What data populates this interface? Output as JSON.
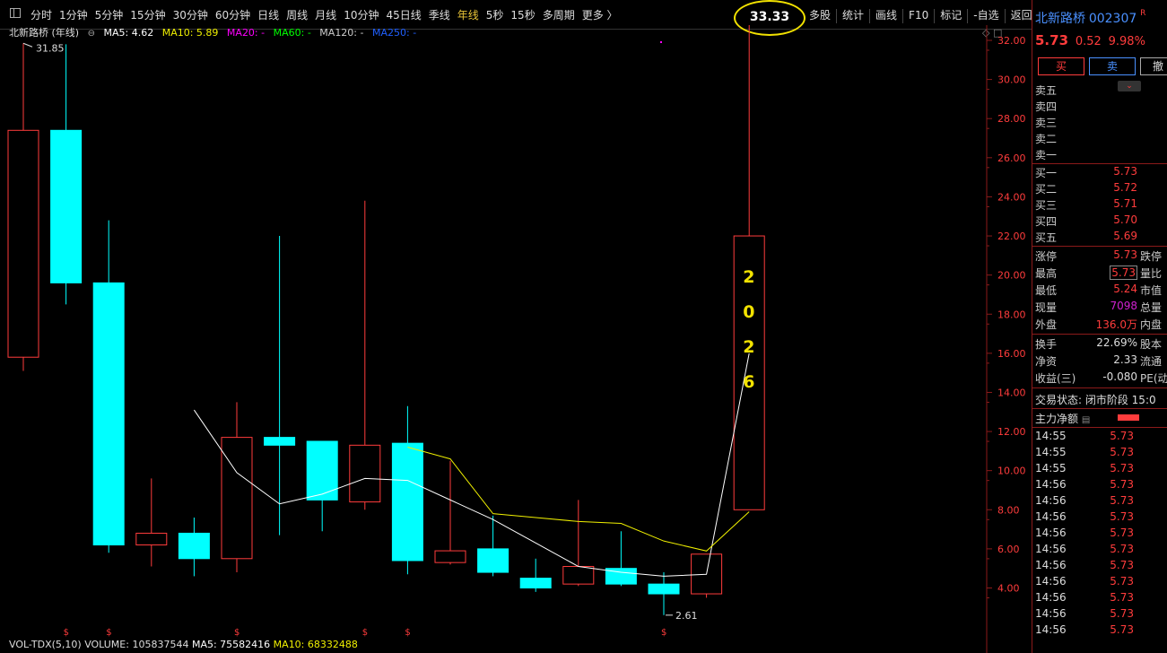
{
  "toolbar": {
    "periods": [
      "分时",
      "1分钟",
      "5分钟",
      "15分钟",
      "30分钟",
      "60分钟",
      "日线",
      "周线",
      "月线",
      "10分钟",
      "45日线",
      "季线",
      "年线",
      "5秒",
      "15秒",
      "多周期",
      "更多 〉"
    ],
    "active_period": "年线",
    "tools": [
      "多股",
      "统计",
      "画线",
      "F10",
      "标记",
      "-自选",
      "返回"
    ],
    "price_callout": "33.33"
  },
  "chart_header": {
    "stock_label": "北新路桥 (年线)",
    "ma5": "MA5: 4.62",
    "ma10": "MA10: 5.89",
    "ma20": "MA20: -",
    "ma60": "MA60: -",
    "ma120": "MA120: -",
    "ma250": "MA250: -"
  },
  "colors": {
    "up": "#ff3c3c",
    "down": "#00ffff",
    "ma5": "#ffffff",
    "ma10": "#f0f000",
    "ma20": "#ff00ff",
    "ma60": "#00ff00",
    "ma120": "#cccccc",
    "ma250": "#2060ff",
    "callout": "#f2e200"
  },
  "annotations": {
    "high_label": "31.85",
    "low_label": "2.61",
    "vertical_text": [
      "2",
      "0",
      "2",
      "6"
    ]
  },
  "volume_header": {
    "vol": "VOL-TDX(5,10)",
    "volume": "VOLUME: 105837544",
    "ma5": "MA5: 75582416",
    "ma10": "MA10: 68332488"
  },
  "chart_data": {
    "type": "candlestick",
    "y_axis_ticks": [
      "32.00",
      "30.00",
      "28.00",
      "26.00",
      "24.00",
      "22.00",
      "20.00",
      "18.00",
      "16.00",
      "14.00",
      "12.00",
      "10.00",
      "8.00",
      "6.00",
      "4.00"
    ],
    "ylim": [
      2.0,
      33.0
    ],
    "candles": [
      {
        "open": 15.8,
        "close": 27.4,
        "high": 31.85,
        "low": 15.1
      },
      {
        "open": 27.4,
        "close": 19.6,
        "high": 31.8,
        "low": 18.5
      },
      {
        "open": 19.6,
        "close": 6.2,
        "high": 22.8,
        "low": 5.8
      },
      {
        "open": 6.2,
        "close": 6.8,
        "high": 9.6,
        "low": 5.1
      },
      {
        "open": 6.8,
        "close": 5.5,
        "high": 7.6,
        "low": 4.6
      },
      {
        "open": 5.5,
        "close": 11.7,
        "high": 13.5,
        "low": 4.8
      },
      {
        "open": 11.7,
        "close": 11.3,
        "high": 22.0,
        "low": 6.7
      },
      {
        "open": 11.5,
        "close": 8.5,
        "high": 11.5,
        "low": 6.9
      },
      {
        "open": 8.4,
        "close": 11.3,
        "high": 23.8,
        "low": 8.0
      },
      {
        "open": 11.4,
        "close": 5.4,
        "high": 13.3,
        "low": 4.7
      },
      {
        "open": 5.3,
        "close": 5.9,
        "high": 10.5,
        "low": 5.2
      },
      {
        "open": 6.0,
        "close": 4.8,
        "high": 7.7,
        "low": 4.6
      },
      {
        "open": 4.5,
        "close": 4.0,
        "high": 5.5,
        "low": 3.8
      },
      {
        "open": 4.2,
        "close": 5.1,
        "high": 8.5,
        "low": 4.1
      },
      {
        "open": 5.0,
        "close": 4.2,
        "high": 6.9,
        "low": 4.1
      },
      {
        "open": 4.2,
        "close": 3.7,
        "high": 4.8,
        "low": 2.61
      },
      {
        "open": 3.7,
        "close": 5.73,
        "high": 5.73,
        "low": 3.5
      },
      {
        "open": 8.0,
        "close": 22.0,
        "high": 33.33,
        "low": 8.0
      }
    ],
    "ma5_line": [
      null,
      null,
      null,
      null,
      13.1,
      9.9,
      8.3,
      8.8,
      9.6,
      9.5,
      8.5,
      7.5,
      6.3,
      5.1,
      4.8,
      4.6,
      4.7,
      16.0
    ],
    "ma10_line": [
      null,
      null,
      null,
      null,
      null,
      null,
      null,
      null,
      null,
      11.2,
      10.6,
      7.8,
      7.6,
      7.4,
      7.3,
      6.4,
      5.89,
      7.9
    ],
    "markers": [
      1,
      2,
      5,
      8,
      9,
      15
    ]
  },
  "panel": {
    "name": "北新路桥",
    "code": "002307",
    "r_flag": "R",
    "price": "5.73",
    "change": "0.52",
    "change_pct": "9.98%",
    "buy_btn": "买",
    "sell_btn": "卖",
    "cancel_btn": "撤",
    "asks": [
      "卖五",
      "卖四",
      "卖三",
      "卖二",
      "卖一"
    ],
    "bids": [
      {
        "label": "买一",
        "price": "5.73"
      },
      {
        "label": "买二",
        "price": "5.72"
      },
      {
        "label": "买三",
        "price": "5.71"
      },
      {
        "label": "买四",
        "price": "5.70"
      },
      {
        "label": "买五",
        "price": "5.69"
      }
    ],
    "stats": [
      {
        "l": "涨停",
        "v": "5.73",
        "c": "red",
        "l2": "跌停"
      },
      {
        "l": "最高",
        "v": "5.73",
        "c": "red",
        "l2": "量比",
        "boxed": true
      },
      {
        "l": "最低",
        "v": "5.24",
        "c": "red",
        "l2": "市值"
      },
      {
        "l": "现量",
        "v": "7098",
        "c": "purple",
        "l2": "总量"
      },
      {
        "l": "外盘",
        "v": "136.0万",
        "c": "red",
        "l2": "内盘"
      }
    ],
    "stats2": [
      {
        "l": "换手",
        "v": "22.69%",
        "c": "white",
        "l2": "股本"
      },
      {
        "l": "净资",
        "v": "2.33",
        "c": "white",
        "l2": "流通"
      },
      {
        "l": "收益(三)",
        "v": "-0.080",
        "c": "white",
        "l2": "PE(动"
      }
    ],
    "trade_status": "交易状态: 闭市阶段 15:0",
    "main_flow": "主力净额",
    "ticks": [
      {
        "t": "14:55",
        "p": "5.73"
      },
      {
        "t": "14:55",
        "p": "5.73"
      },
      {
        "t": "14:55",
        "p": "5.73"
      },
      {
        "t": "14:56",
        "p": "5.73"
      },
      {
        "t": "14:56",
        "p": "5.73"
      },
      {
        "t": "14:56",
        "p": "5.73"
      },
      {
        "t": "14:56",
        "p": "5.73"
      },
      {
        "t": "14:56",
        "p": "5.73"
      },
      {
        "t": "14:56",
        "p": "5.73"
      },
      {
        "t": "14:56",
        "p": "5.73"
      },
      {
        "t": "14:56",
        "p": "5.73"
      },
      {
        "t": "14:56",
        "p": "5.73"
      },
      {
        "t": "14:56",
        "p": "5.73"
      }
    ]
  }
}
